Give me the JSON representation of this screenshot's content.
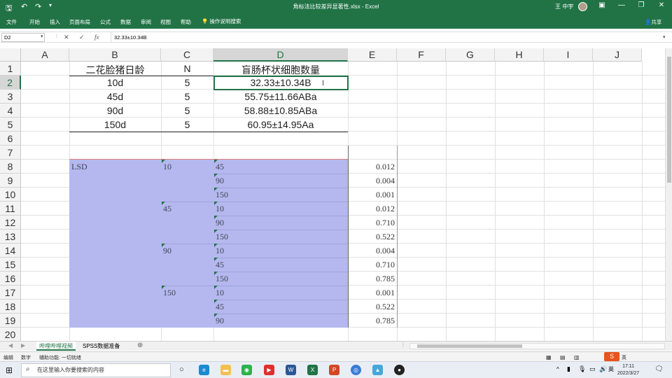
{
  "titlebar": {
    "document_title": "角标法比较差异显著性.xlsx - Excel",
    "user_name": "王 中宇",
    "save_icon": "save-icon",
    "undo_icon": "undo-icon",
    "redo_icon": "redo-icon",
    "accent": "#217346"
  },
  "ribbon": {
    "tabs": [
      "文件",
      "开始",
      "插入",
      "页面布局",
      "公式",
      "数据",
      "审阅",
      "视图",
      "帮助"
    ],
    "tell_me": "操作说明搜索",
    "share": "共享"
  },
  "formula_bar": {
    "name_box": "D2",
    "formula": "32.33±10.34B",
    "cancel": "✕",
    "enter": "✓",
    "fx": "fx"
  },
  "grid": {
    "columns": [
      "A",
      "B",
      "C",
      "D",
      "E",
      "F",
      "G",
      "H",
      "I",
      "J"
    ],
    "rows": [
      "1",
      "2",
      "3",
      "4",
      "5",
      "6",
      "7",
      "8",
      "9",
      "10",
      "11",
      "12",
      "13",
      "14",
      "15",
      "16",
      "17",
      "18",
      "19",
      "20"
    ],
    "selected_column": "D",
    "selected_row": "2"
  },
  "table1": {
    "headers": [
      "二花脸猪日龄",
      "N",
      "盲肠杯状细胞数量"
    ],
    "rows": [
      [
        "10d",
        "5",
        "32.33±10.34B"
      ],
      [
        "45d",
        "5",
        "55.75±11.66ABa"
      ],
      [
        "90d",
        "5",
        "58.88±10.85ABa"
      ],
      [
        "150d",
        "5",
        "60.95±14.95Aa"
      ]
    ]
  },
  "table2": {
    "label": "LSD",
    "groups": [
      "10",
      "45",
      "90",
      "150"
    ],
    "comparisons": [
      "45",
      "90",
      "150",
      "10",
      "90",
      "150",
      "10",
      "45",
      "150",
      "10",
      "45",
      "90"
    ],
    "pvalues": [
      "0.012",
      "0.004",
      "0.001",
      "0.012",
      "0.710",
      "0.522",
      "0.004",
      "0.710",
      "0.785",
      "0.001",
      "0.522",
      "0.785"
    ]
  },
  "sheets": {
    "tabs": [
      "哔哩哔哩视频",
      "SPSS数据准备"
    ],
    "active": "哔哩哔哩视频"
  },
  "statusbar": {
    "mode": "编辑",
    "numlock": "数字",
    "accessibility": "辅助功能: 一切就绪",
    "ime": "英"
  },
  "taskbar": {
    "search_placeholder": "在这里输入你要搜索的内容",
    "time": "17:11",
    "date": "2022/3/27"
  }
}
